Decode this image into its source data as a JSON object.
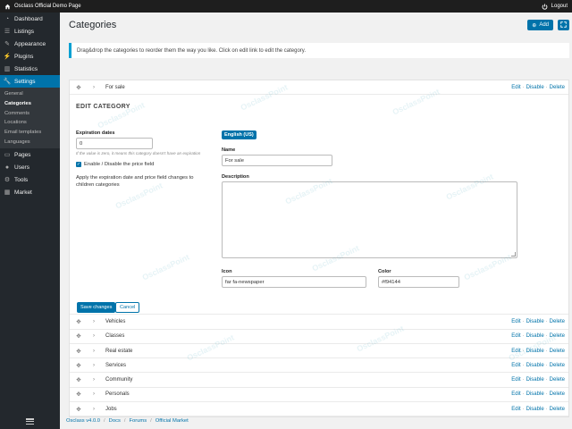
{
  "topbar": {
    "site_title": "Osclass Official Demo Page",
    "logout_label": "Logout",
    "home_icon": "home-icon",
    "power_icon": "power-icon"
  },
  "sidebar": {
    "items": [
      {
        "label": "Dashboard",
        "icon": "dashboard-icon"
      },
      {
        "label": "Listings",
        "icon": "list-icon"
      },
      {
        "label": "Appearance",
        "icon": "brush-icon"
      },
      {
        "label": "Plugins",
        "icon": "plugin-icon"
      },
      {
        "label": "Statistics",
        "icon": "chart-icon"
      },
      {
        "label": "Settings",
        "icon": "wrench-icon"
      }
    ],
    "settings_sub": [
      "General",
      "Categories",
      "Comments",
      "Locations",
      "Email templates",
      "Languages"
    ],
    "items_after": [
      {
        "label": "Pages",
        "icon": "page-icon"
      },
      {
        "label": "Users",
        "icon": "user-icon"
      },
      {
        "label": "Tools",
        "icon": "tools-icon"
      },
      {
        "label": "Market",
        "icon": "market-icon"
      }
    ]
  },
  "page": {
    "title": "Categories",
    "add_label": "Add",
    "notice": "Drag&drop the categories to reorder them the way you like. Click on edit link to edit the category."
  },
  "actions": {
    "edit": "Edit",
    "disable": "Disable",
    "delete": "Delete",
    "sep": "·"
  },
  "current_category": "For sale",
  "edit_form": {
    "heading": "EDIT CATEGORY",
    "expiration_label": "Expiration dates",
    "expiration_value": "0",
    "expiration_hint": "If the value is zero, it means this category doesn't have an expiration",
    "price_toggle_label": "Enable / Disable the price field",
    "apply_text": "Apply the expiration date and price field changes to children categories",
    "language_badge": "English (US)",
    "name_label": "Name",
    "name_value": "For sale",
    "description_label": "Description",
    "description_value": "",
    "icon_label": "Icon",
    "icon_value": "far fa-newspaper",
    "color_label": "Color",
    "color_value": "#f94144",
    "save_label": "Save changes",
    "cancel_label": "Cancel"
  },
  "categories": [
    "Vehicles",
    "Classes",
    "Real estate",
    "Services",
    "Community",
    "Personals",
    "Jobs"
  ],
  "footer": {
    "version": "Osclass v4.0.0",
    "docs": "Docs",
    "forums": "Forums",
    "market": "Official Market",
    "sep": "/"
  },
  "watermark": "OsclassPoint",
  "colors": {
    "accent": "#0073aa",
    "sidebar": "#23282d",
    "topbar": "#1e1e1e"
  }
}
